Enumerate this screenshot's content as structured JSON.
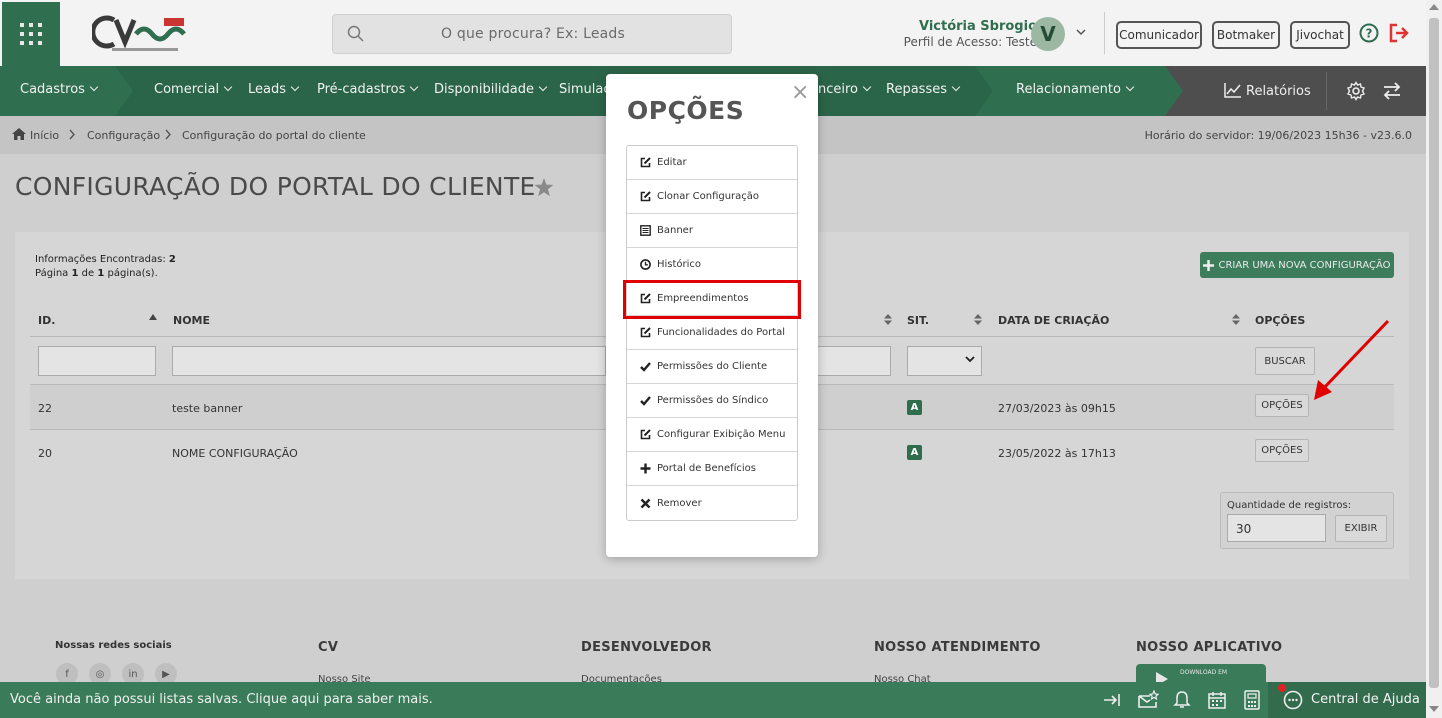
{
  "header": {
    "search_placeholder": "O que procura? Ex: Leads",
    "user_name": "Victória Sbrogio",
    "user_profile": "Perfil de Acesso: Teste",
    "avatar_letter": "V",
    "buttons": [
      "Comunicador",
      "Botmaker",
      "Jivochat"
    ]
  },
  "nav": {
    "items": [
      "Cadastros",
      "Comercial",
      "Leads",
      "Pré-cadastros",
      "Disponibilidade",
      "Simulaç",
      "nceiro",
      "Repasses",
      "Relacionamento"
    ],
    "reports": "Relatórios"
  },
  "breadcrumb": {
    "items": [
      "Início",
      "Configuração",
      "Configuração do portal do cliente"
    ],
    "server_time": "Horário do servidor: 19/06/2023 15h36 - v23.6.0"
  },
  "page": {
    "title": "CONFIGURAÇÃO DO PORTAL DO CLIENTE",
    "info_found_label": "Informações Encontradas:",
    "info_found_value": "2",
    "page_word": "Página",
    "page_current": "1",
    "page_of": "de",
    "page_total": "1",
    "page_suffix": "página(s).",
    "new_config_button": "CRIAR UMA NOVA CONFIGURAÇÃO"
  },
  "table": {
    "headers": [
      "ID.",
      "NOME",
      "SIT.",
      "DATA DE CRIAÇÃO",
      "OPÇÕES"
    ],
    "search_button": "BUSCAR",
    "rows": [
      {
        "id": "22",
        "name": "teste banner",
        "status": "A",
        "date": "27/03/2023 às 09h15",
        "options": "OPÇÕES"
      },
      {
        "id": "20",
        "name": "NOME CONFIGURAÇÃO",
        "status": "A",
        "date": "23/05/2022 às 17h13",
        "options": "OPÇÕES"
      }
    ],
    "qty_label": "Quantidade de registros:",
    "qty_value": "30",
    "show_button": "EXIBIR"
  },
  "footer": {
    "social_title": "Nossas redes sociais",
    "cols": [
      "CV",
      "DESENVOLVEDOR",
      "NOSSO ATENDIMENTO",
      "NOSSO APLICATIVO"
    ],
    "links": [
      "Nosso Site",
      "Documentações",
      "Nosso Chat"
    ],
    "gplay_small": "DOWNLOAD EM"
  },
  "bottombar": {
    "message": "Você ainda não possui listas salvas. Clique aqui para saber mais.",
    "help_center": "Central de Ajuda"
  },
  "modal": {
    "title": "OPÇÕES",
    "close": "×",
    "items": [
      {
        "label": "Editar",
        "icon": "edit-icon"
      },
      {
        "label": "Clonar Configuração",
        "icon": "edit-icon"
      },
      {
        "label": "Banner",
        "icon": "list-icon"
      },
      {
        "label": "Histórico",
        "icon": "clock-icon"
      },
      {
        "label": "Empreendimentos",
        "icon": "edit-icon"
      },
      {
        "label": "Funcionalidades do Portal",
        "icon": "edit-icon"
      },
      {
        "label": "Permissões do Cliente",
        "icon": "check-icon"
      },
      {
        "label": "Permissões do Síndico",
        "icon": "check-icon"
      },
      {
        "label": "Configurar Exibição Menu",
        "icon": "edit-icon"
      },
      {
        "label": "Portal de Benefícios",
        "icon": "plus-icon"
      },
      {
        "label": "Remover",
        "icon": "x-icon"
      }
    ]
  },
  "colors": {
    "brand_green": "#2f6e4f",
    "highlight_red": "#e00000"
  }
}
